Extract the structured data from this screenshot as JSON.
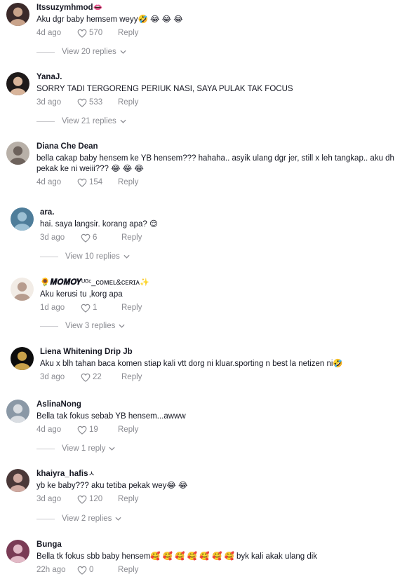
{
  "reply_label": "Reply",
  "comments": [
    {
      "username": "Itssuzymhmod",
      "username_badge": "👄",
      "text": "Aku dgr baby hemsem weyy🤣 😂 😂 😂",
      "date": "4d ago",
      "likes": "570",
      "view_replies": "View 20 replies",
      "avatar_colors": [
        "#3b2a2a",
        "#c9a38a"
      ]
    },
    {
      "username": "YanaJ.",
      "username_badge": "",
      "text": "SORRY TADI TERGORENG PERIUK NASI, SAYA PULAK TAK FOCUS",
      "date": "3d ago",
      "likes": "533",
      "view_replies": "View 21 replies",
      "avatar_colors": [
        "#1e1a1a",
        "#d8b49a"
      ]
    },
    {
      "username": "Diana Che Dean",
      "username_badge": "",
      "text": "bella cakap baby hensem ke YB hensem??? hahaha.. asyik ulang dgr jer, still x leh tangkap.. aku dh pekak ke ni weiii??? 😂 😂 😂",
      "date": "4d ago",
      "likes": "154",
      "view_replies": "",
      "avatar_colors": [
        "#b8b0a8",
        "#6d625c"
      ]
    },
    {
      "username": "ara.",
      "username_badge": "",
      "text": "hai. saya langsir. korang apa? 😌",
      "date": "3d ago",
      "likes": "6",
      "view_replies": "View 10 replies",
      "avatar_colors": [
        "#4e7d9a",
        "#9cc0d4"
      ]
    },
    {
      "username": "🌻𝑴𝑶𝑴𝑶𝒀",
      "username_badge": "ᵁᴳᶜ_ᴄᴏᴍᴇʟ&ᴄᴇʀɪᴀ✨",
      "text": "Aku kerusi tu ,korg apa",
      "date": "1d ago",
      "likes": "1",
      "view_replies": "View 3 replies",
      "avatar_colors": [
        "#f2ece6",
        "#b79c8e"
      ]
    },
    {
      "username": "Liena Whitening Drip Jb",
      "username_badge": "",
      "text": "Aku x blh tahan baca komen stiap kali vtt dorg ni kluar.sporting n best la netizen ni🤣",
      "date": "3d ago",
      "likes": "22",
      "view_replies": "",
      "avatar_colors": [
        "#0d0d0d",
        "#c8a14a"
      ]
    },
    {
      "username": "AslinaNong",
      "username_badge": "",
      "text": "Bella tak fokus sebab YB hensem...awww",
      "date": "4d ago",
      "likes": "19",
      "view_replies": "View 1 reply",
      "avatar_colors": [
        "#8a98a6",
        "#d9dde2"
      ]
    },
    {
      "username": "khaiyra_hafis",
      "username_badge": "ㅅ",
      "text": "yb ke baby??? aku tetiba pekak wey😂 😂",
      "date": "3d ago",
      "likes": "120",
      "view_replies": "View 2 replies",
      "avatar_colors": [
        "#4a3838",
        "#cfa9a0"
      ]
    },
    {
      "username": "Bunga",
      "username_badge": "",
      "text": "Bella tk fokus sbb baby hensem🥰 🥰 🥰 🥰 🥰 🥰 🥰   byk kali akak ulang dik",
      "date": "22h ago",
      "likes": "0",
      "view_replies": "",
      "avatar_colors": [
        "#7a3b55",
        "#e2b9c6"
      ]
    }
  ]
}
